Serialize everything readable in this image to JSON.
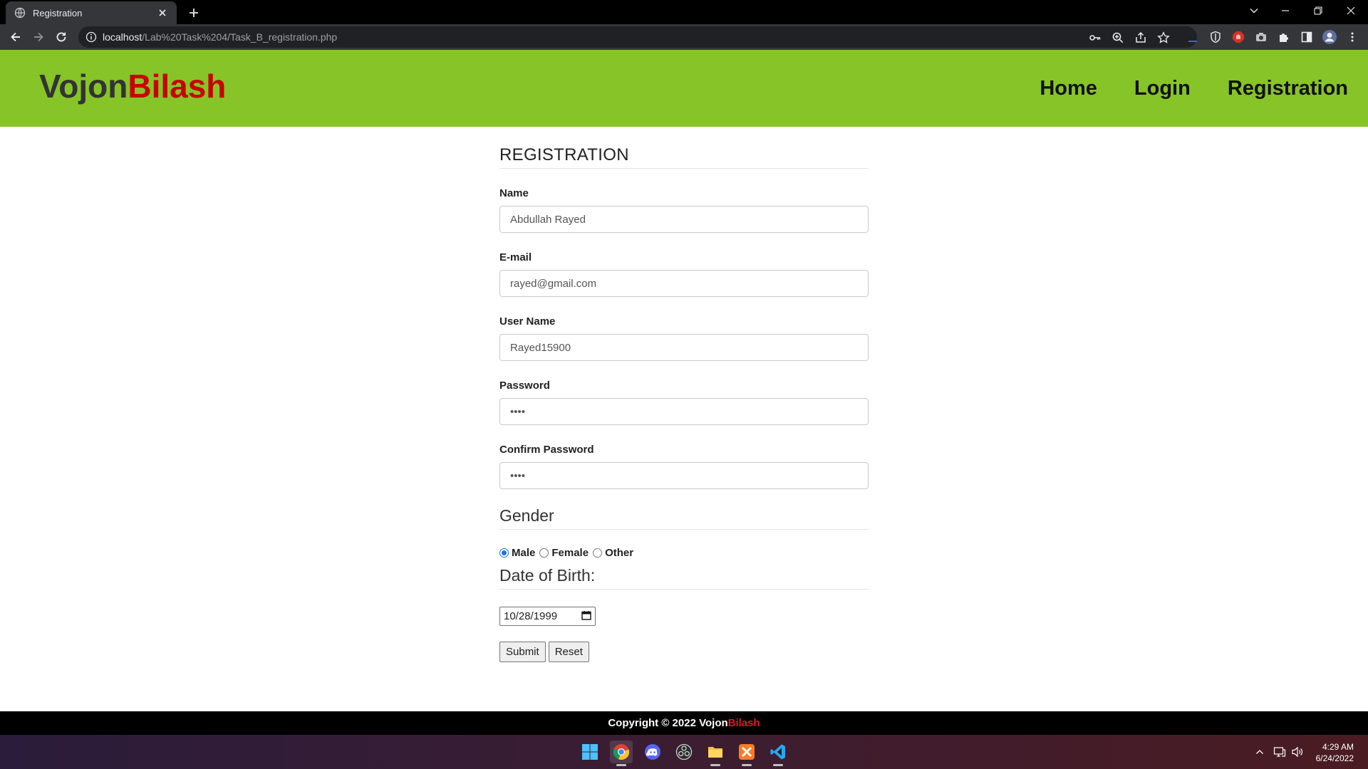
{
  "browser": {
    "tab_title": "Registration",
    "url_host": "localhost",
    "url_path": "/Lab%20Task%204/Task_B_registration.php"
  },
  "site": {
    "logo_part1": "Vojon",
    "logo_part2": "Bilash",
    "nav": [
      "Home",
      "Login",
      "Registration"
    ]
  },
  "form": {
    "title": "REGISTRATION",
    "name_label": "Name",
    "name_value": "Abdullah Rayed",
    "email_label": "E-mail",
    "email_value": "rayed@gmail.com",
    "username_label": "User Name",
    "username_value": "Rayed15900",
    "password_label": "Password",
    "password_value": "••••",
    "confirm_label": "Confirm Password",
    "confirm_value": "••••",
    "gender_title": "Gender",
    "gender_options": [
      "Male",
      "Female",
      "Other"
    ],
    "gender_selected": "Male",
    "dob_title": "Date of Birth:",
    "dob_value": "10/28/1999",
    "submit_label": "Submit",
    "reset_label": "Reset"
  },
  "footer": {
    "text": "Copyright © 2022 Vojon",
    "brand_red": "Bilash"
  },
  "taskbar": {
    "time": "4:29 AM",
    "date": "6/24/2022"
  },
  "colors": {
    "header_green": "#86c427",
    "logo_red": "#c80000",
    "footer_red": "#e01b1b"
  }
}
